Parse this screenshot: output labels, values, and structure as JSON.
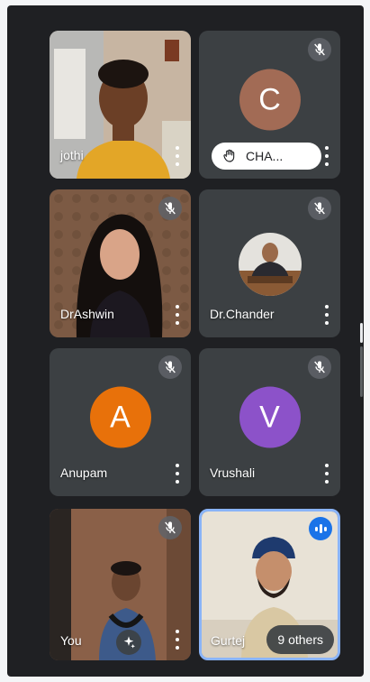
{
  "colors": {
    "background": "#1f2023",
    "tile": "#3c4043",
    "avatar_chandra": "#a26b55",
    "avatar_anupam": "#e8710a",
    "avatar_vrushali": "#8c52c9",
    "active_speaker_border": "#8ab4f8"
  },
  "participants": [
    {
      "name": "jothi",
      "type": "video"
    },
    {
      "initial": "C",
      "badge_label": "CHA...",
      "badge_icon": "raised-hand-icon",
      "muted": true
    },
    {
      "name": "DrAshwin",
      "type": "video",
      "muted": true
    },
    {
      "name": "Dr.Chander",
      "type": "profile-photo",
      "muted": true
    },
    {
      "name": "Anupam",
      "initial": "A",
      "muted": true
    },
    {
      "name": "Vrushali",
      "initial": "V",
      "muted": true
    },
    {
      "name": "You",
      "type": "video",
      "muted": true
    },
    {
      "name": "Gurtej",
      "type": "video",
      "speaking": true
    }
  ],
  "others_count_label": "9 others"
}
